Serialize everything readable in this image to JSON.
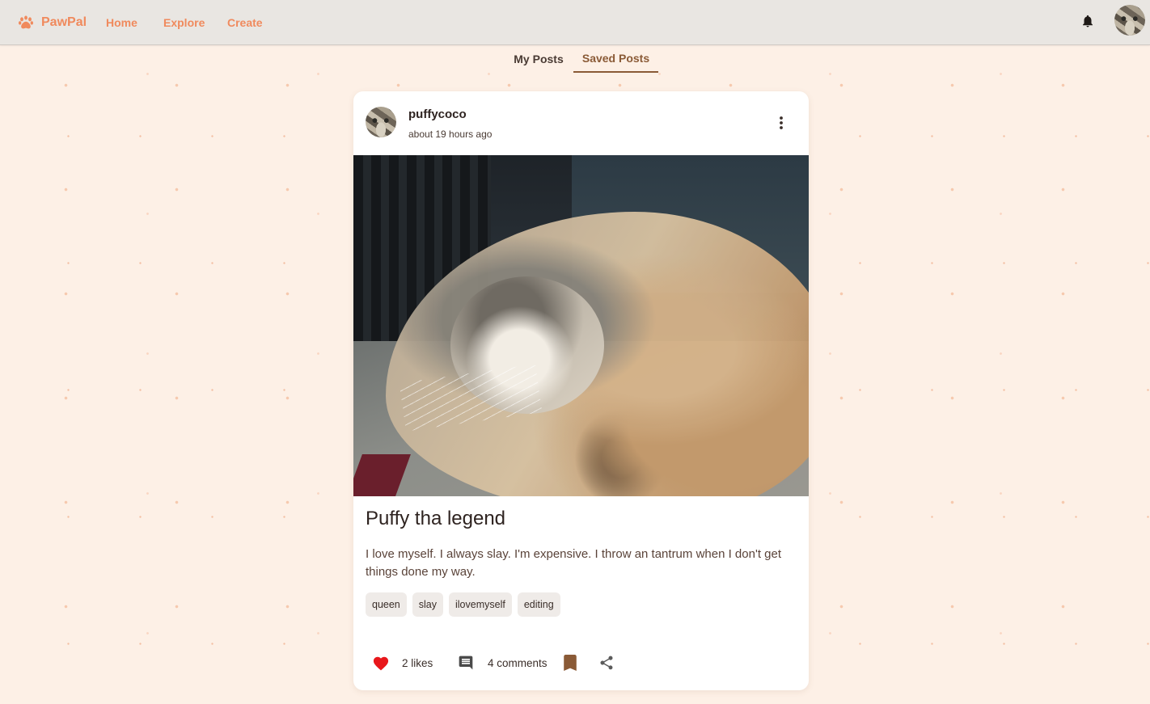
{
  "app": {
    "name": "PawPal",
    "logo_icon": "paw-icon",
    "accent_color": "#f08a5d",
    "background_color": "#fdf0e6"
  },
  "nav": {
    "links": [
      "Home",
      "Explore",
      "Create"
    ],
    "notification_icon": "bell-icon",
    "avatar": "user-avatar"
  },
  "tabs": {
    "items": [
      "My Posts",
      "Saved Posts"
    ],
    "active": "Saved Posts"
  },
  "post": {
    "username": "puffycoco",
    "timestamp": "about 19 hours ago",
    "title": "Puffy tha legend",
    "description": "I love myself. I always slay. I'm expensive. I throw an tantrum when I don't get things done my way.",
    "tags": [
      "queen",
      "slay",
      "ilovemyself",
      "editing"
    ],
    "likes_label": "2 likes",
    "comments_label": "4 comments",
    "liked": true,
    "saved": true,
    "like_color": "#e8171b",
    "bookmark_color": "#8a5a36",
    "icons": [
      "more-vert-icon",
      "heart-icon",
      "comment-icon",
      "bookmark-icon",
      "share-icon"
    ]
  }
}
